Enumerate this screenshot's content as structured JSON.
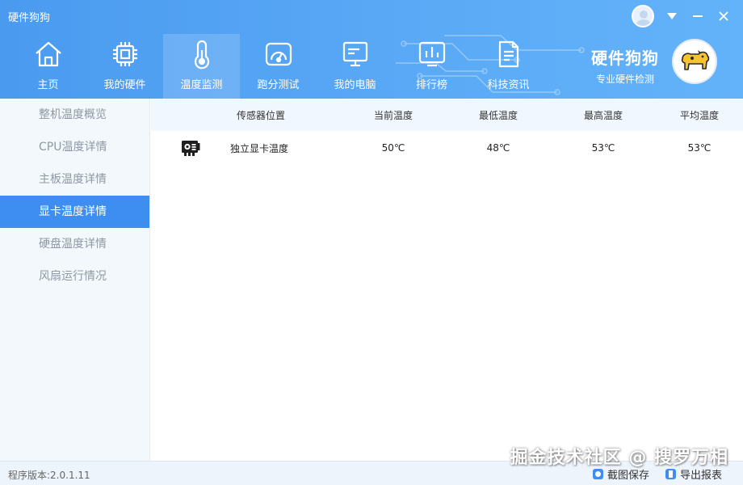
{
  "app": {
    "title": "硬件狗狗",
    "brand_name": "硬件狗狗",
    "brand_sub": "专业硬件检测"
  },
  "window_controls": {
    "user": "user-avatar",
    "menu": "dropdown-icon",
    "minimize": "minimize-icon",
    "close": "close-icon"
  },
  "nav": {
    "active_index": 2,
    "items": [
      {
        "label": "主页",
        "icon": "home-icon"
      },
      {
        "label": "我的硬件",
        "icon": "chip-icon"
      },
      {
        "label": "温度监测",
        "icon": "thermometer-icon"
      },
      {
        "label": "跑分测试",
        "icon": "gauge-icon"
      },
      {
        "label": "我的电脑",
        "icon": "monitor-icon"
      },
      {
        "label": "排行榜",
        "icon": "ranking-icon"
      },
      {
        "label": "科技资讯",
        "icon": "news-icon"
      }
    ]
  },
  "sidebar": {
    "active_index": 3,
    "items": [
      {
        "label": "整机温度概览"
      },
      {
        "label": "CPU温度详情"
      },
      {
        "label": "主板温度详情"
      },
      {
        "label": "显卡温度详情"
      },
      {
        "label": "硬盘温度详情"
      },
      {
        "label": "风扇运行情况"
      }
    ]
  },
  "table": {
    "headers": [
      "传感器位置",
      "当前温度",
      "最低温度",
      "最高温度",
      "平均温度"
    ],
    "rows": [
      {
        "icon": "graphics-card-icon",
        "name": "独立显卡温度",
        "current": "50℃",
        "min": "48℃",
        "max": "53℃",
        "avg": "53℃"
      }
    ]
  },
  "footer": {
    "version": "程序版本:2.0.1.11",
    "screenshot_label": "截图保存",
    "export_label": "导出报表"
  },
  "watermark": "掘金技术社区 @ 搜罗万相",
  "colors": {
    "header": "#4a9af0",
    "accent": "#3d8ef0",
    "sidebar_bg": "#f3f8fd",
    "table_header_bg": "#f1f7fe"
  }
}
